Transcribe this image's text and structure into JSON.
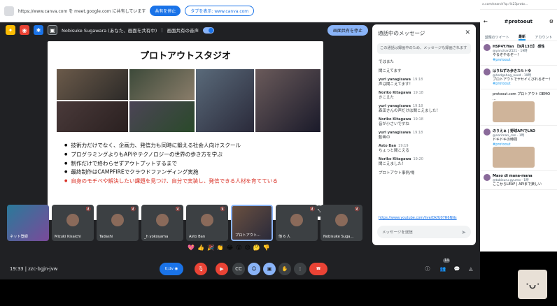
{
  "sharebar": {
    "url_text": "https://www.canva.com を meet.google.com に共有しています",
    "stop_share_label": "共有を停止",
    "switch_tab_label": "タブを表示: www.canva.com"
  },
  "presenting": {
    "label": "Nobisuke Sugawara (あなた、画面を共有中)",
    "audio_label": "画面共有の音声",
    "stop_label": "画面共有を停止"
  },
  "slide": {
    "title": "プロトアウトスタジオ",
    "bullets": [
      {
        "text": "技術力だけでなく、企画力、発信力も同時に鍛える社会人向けスクール",
        "red": false
      },
      {
        "text": "プログラミングよりもAPIやテクノロジーの世界の歩き方を学ぶ",
        "red": false
      },
      {
        "text": "制作だけで終わらせずアウトプットするまで",
        "red": false
      },
      {
        "text": "最終制作はCAMPFIREでクラウドファンディング実施",
        "red": false
      },
      {
        "text": "自身のモチベや解決したい課題を見つけ、自分で実装し、発信できる人材を育てている",
        "red": true
      }
    ]
  },
  "chat": {
    "title": "通話中のメッセージ",
    "notice": "この通話は録画中のため、メッセージも録画されます",
    "messages": [
      {
        "who": "",
        "time": "",
        "text": "ではまた"
      },
      {
        "who": "",
        "time": "",
        "text": "聞こえてます"
      },
      {
        "who": "yuri yanagisawa",
        "time": "19:18",
        "text": "声は聞こえてます！"
      },
      {
        "who": "Noriko Kitagawa",
        "time": "19:18",
        "text": "きこえた"
      },
      {
        "who": "yuri yanagisawa",
        "time": "19:18",
        "text": "森田さんの声だけは聞こえました！"
      },
      {
        "who": "Noriko Kitagawa",
        "time": "19:18",
        "text": "音が小さいですね"
      },
      {
        "who": "yuri yanagisawa",
        "time": "19:18",
        "text": "動画の"
      },
      {
        "who": "Asto Ban",
        "time": "19:19",
        "text": "ちょっと聞こえる"
      },
      {
        "who": "Noriko Kitagawa",
        "time": "19:20",
        "text": "聞こえました！"
      },
      {
        "who": "",
        "time": "",
        "text": "プロトアウト事例/場"
      }
    ],
    "link": "https://www.youtube.com/live/DkfU07R6NNs",
    "input_placeholder": "メッセージを送信"
  },
  "tiles": [
    {
      "name": "ネット登録",
      "self": true
    },
    {
      "name": "Mizuki Kisaichi"
    },
    {
      "name": "Tadashi"
    },
    {
      "name": "_h yokoyama"
    },
    {
      "name": "Asto Ban"
    },
    {
      "name": "プロトアウト...",
      "active": true
    },
    {
      "name": "他 6 人"
    },
    {
      "name": "Nobisuke Suga..."
    }
  ],
  "controls": {
    "time_code": "19:33 | zzc-bgjn-jvw",
    "participants_badge": "14"
  },
  "x": {
    "urlbar": "x.com/search?q=%23proto...",
    "hashtag": "#protoout",
    "tabs": [
      "話題のツイート",
      "最新",
      "アカウント"
    ],
    "tweets": [
      {
        "name": "HSP4Y/Yan 【9月13日】 感性",
        "handle": "@yanchan2521 · 19時",
        "text": "やるぞやるぞー！",
        "hash": "#protoout"
      },
      {
        "name": "はりねずみ歩きカルトゆ",
        "handle": "@hedgehog_nood · 19時",
        "text": "プロトアウトでヤセイくびれるぞー！",
        "hash": "#protoout"
      },
      {
        "name": "",
        "handle": "",
        "text": "protoout.com プロトアウト DEMO ...",
        "hash": ""
      },
      {
        "name": "のりえぁ | 野球APIでLAD",
        "handle": "@noriman_can · 1時",
        "text": "ドキドキの時間",
        "hash": "#protoout"
      },
      {
        "name": "Maso di mana-mana",
        "handle": "@tabisuru.gyumo · 1時",
        "text": "ここからLEAF | APIまで楽しい",
        "hash": ""
      }
    ]
  }
}
